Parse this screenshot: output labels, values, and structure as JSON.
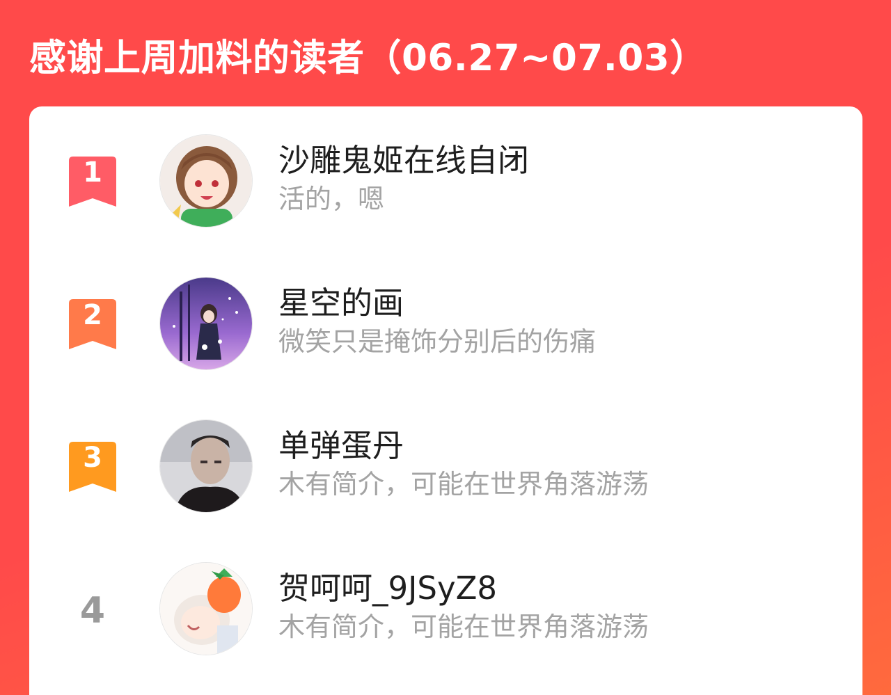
{
  "header": {
    "title": "感谢上周加料的读者（06.27~07.03）"
  },
  "colors": {
    "background": "#ff4a4a",
    "rank1": "#ff5c66",
    "rank2": "#ff7a4a",
    "rank3": "#ff9a1f",
    "rank_plain": "#9a9a9a",
    "name_text": "#1e1e1e",
    "bio_text": "#a3a3a3"
  },
  "readers": [
    {
      "rank": "1",
      "avatar_icon": "anime-girl-avatar",
      "name": "沙雕鬼姬在线自闭",
      "bio": "活的，嗯"
    },
    {
      "rank": "2",
      "avatar_icon": "starry-night-girl-avatar",
      "name": "星空的画",
      "bio": "微笑只是掩饰分别后的伤痛"
    },
    {
      "rank": "3",
      "avatar_icon": "man-portrait-avatar",
      "name": "单弹蛋丹",
      "bio": "木有简介，可能在世界角落游荡"
    },
    {
      "rank": "4",
      "avatar_icon": "carrot-chibi-avatar",
      "name": "贺呵呵_9JSyZ8",
      "bio": "木有简介，可能在世界角落游荡"
    }
  ]
}
